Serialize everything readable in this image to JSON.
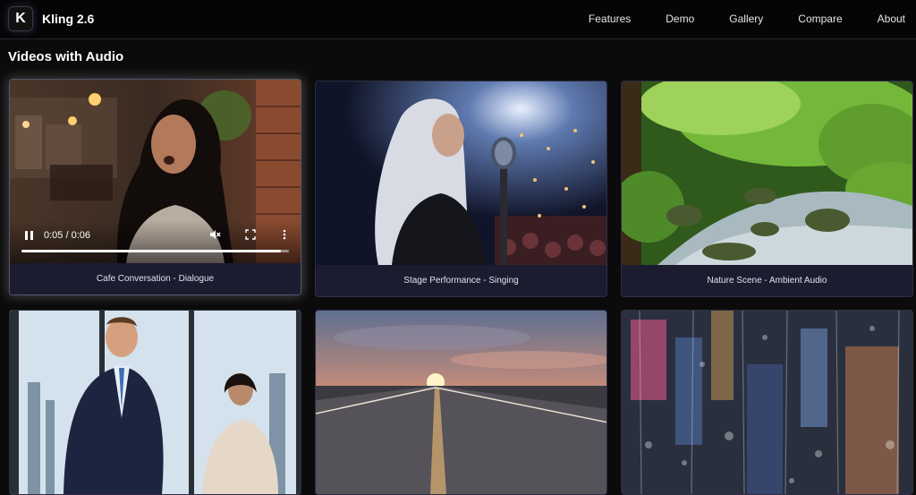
{
  "app": {
    "name": "Kling 2.6",
    "logo_letter": "K"
  },
  "nav": {
    "links": [
      "Features",
      "Demo",
      "Gallery",
      "Compare",
      "About"
    ]
  },
  "section": {
    "title": "Videos with Audio"
  },
  "video_cards": [
    {
      "label": "Cafe Conversation - Dialogue",
      "thumbnail_icon": "cafe-woman-thumbnail"
    },
    {
      "label": "Stage Performance - Singing",
      "thumbnail_icon": "singer-thumbnail"
    },
    {
      "label": "Nature Scene - Ambient Audio",
      "thumbnail_icon": "forest-stream-thumbnail"
    },
    {
      "thumbnail_icon": "business-meeting-thumbnail"
    },
    {
      "thumbnail_icon": "sunset-road-thumbnail"
    },
    {
      "thumbnail_icon": "rainy-window-thumbnail"
    }
  ],
  "player": {
    "time": "0:05 / 0:06",
    "progress": 0.97,
    "icons": [
      "pause-icon",
      "mute-icon",
      "fullscreen-icon",
      "more-options-icon"
    ]
  },
  "colors": {
    "card_bg": "#1c1c31",
    "page_bg": "#0b0b0c",
    "nav_bg": "#050506"
  }
}
